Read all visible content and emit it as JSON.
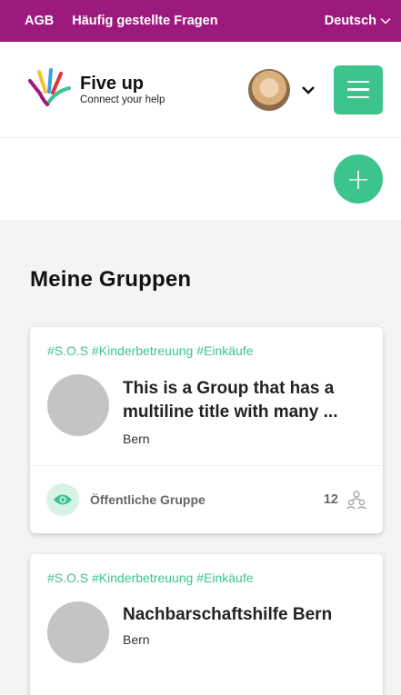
{
  "topbar": {
    "agb": "AGB",
    "faq": "Häufig gestellte Fragen",
    "language": "Deutsch"
  },
  "header": {
    "brand_name": "Five up",
    "brand_tagline": "Connect your help"
  },
  "main": {
    "section_title": "Meine Gruppen"
  },
  "groups": [
    {
      "tags": "#S.O.S #Kinderbetreuung #Einkäufe",
      "title": "This is a Group that has a multiline title with many ...",
      "location": "Bern",
      "visibility": "Öffentliche Gruppe",
      "member_count": "12"
    },
    {
      "tags": "#S.O.S #Kinderbetreuung #Einkäufe",
      "title": "Nachbarschaftshilfe Bern",
      "location": "Bern"
    }
  ],
  "colors": {
    "topbar": "#9c1a7d",
    "accent": "#3dc48d"
  }
}
